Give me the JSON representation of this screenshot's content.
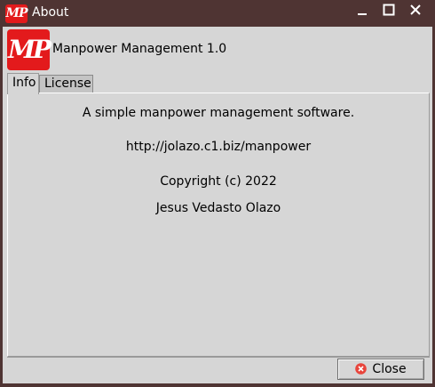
{
  "window": {
    "title": "About",
    "title_logo_text": "MP"
  },
  "app": {
    "logo_text": "MP",
    "name": "Manpower Management 1.0",
    "logo_color": "#e31a1c"
  },
  "tabs": [
    {
      "label": "Info",
      "selected": true
    },
    {
      "label": "License",
      "selected": false
    }
  ],
  "info": {
    "description": "A simple manpower management software.",
    "url": "http://jolazo.c1.biz/manpower",
    "copyright": "Copyright (c) 2022",
    "author": "Jesus Vedasto Olazo"
  },
  "footer": {
    "close_label": "Close",
    "close_icon": "close-circle-icon",
    "close_icon_color": "#e8453c"
  },
  "window_controls": {
    "minimize_icon": "minimize-icon",
    "maximize_icon": "maximize-icon",
    "close_icon": "close-icon"
  }
}
